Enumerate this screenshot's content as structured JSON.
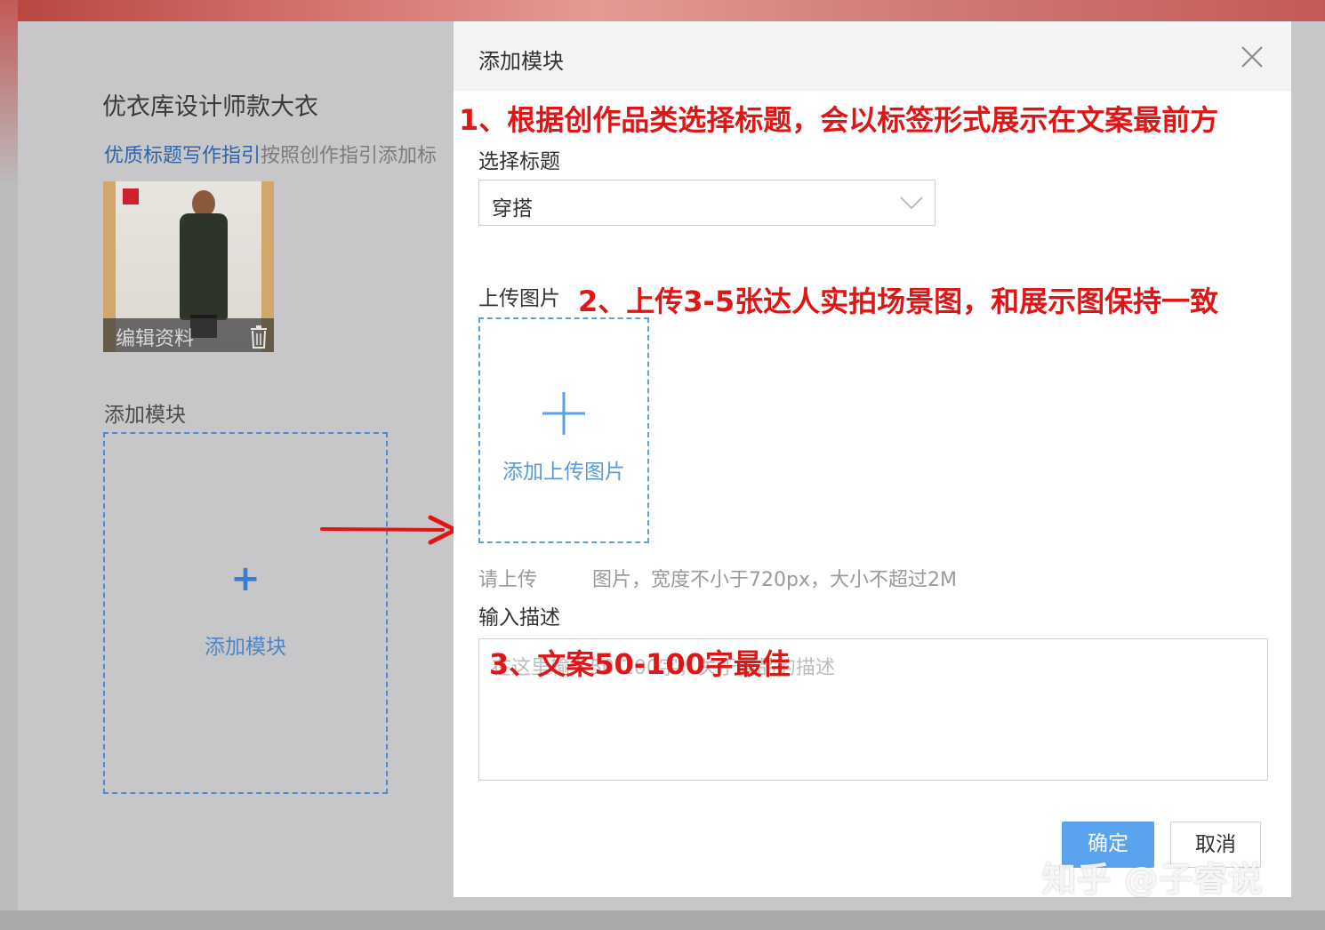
{
  "background": {
    "item_title": "优衣库设计师款大衣",
    "guide_link": "优质标题写作指引",
    "guide_text": "按照创作指引添加标",
    "thumbnail": {
      "edit_label": "编辑资料",
      "trash_icon": "trash-icon"
    },
    "section_label": "添加模块",
    "add_module": {
      "plus": "+",
      "label": "添加模块"
    }
  },
  "dialog": {
    "title": "添加模块",
    "close_icon": "close-icon",
    "select_title_label": "选择标题",
    "select_value": "穿搭",
    "upload_label": "上传图片",
    "upload_button_label": "添加上传图片",
    "upload_hint_prefix": "请上传",
    "upload_hint_suffix": "图片，宽度不小于720px，大小不超过2M",
    "description_label": "输入描述",
    "description_placeholder": "在这里输入50-200字，关于商品的描述",
    "confirm_label": "确定",
    "cancel_label": "取消"
  },
  "annotations": {
    "note1": "1、根据创作品类选择标题，会以标签形式展示在文案最前方",
    "note2": "2、上传3-5张达人实拍场景图，和展示图保持一致",
    "note3": "3、文案50-100字最佳",
    "arrow_color": "#e01616"
  },
  "watermark": "知乎 @子睿说",
  "colors": {
    "accent_blue": "#5aa3ee",
    "link_blue": "#2f64a8",
    "annotation_red": "#e01616"
  }
}
